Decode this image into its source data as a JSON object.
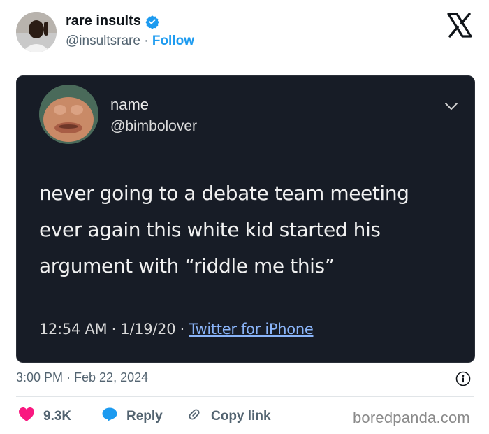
{
  "tweet": {
    "author_name": "rare insults",
    "author_handle": "@insultsrare",
    "separator": "·",
    "follow_label": "Follow",
    "timestamp": "3:00 PM · Feb 22, 2024"
  },
  "embedded_screenshot": {
    "name": "name",
    "handle": "@bimbolover",
    "text_lines": [
      "never going to a debate team meeting",
      "ever again this white kid started his",
      "argument with “riddle me this”"
    ],
    "meta_time": "12:54 AM · 1/19/20 · ",
    "meta_source": "Twitter for iPhone"
  },
  "actions": {
    "like_count": "9.3K",
    "reply_label": "Reply",
    "copy_link_label": "Copy link"
  },
  "watermark": "boredpanda.com",
  "colors": {
    "brand_blue": "#1d9bf0",
    "like_pink": "#f91880",
    "screenshot_bg": "#171c26",
    "muted_text": "#536471"
  },
  "icons": [
    "verified-badge-icon",
    "x-logo-icon",
    "chevron-down-icon",
    "info-icon",
    "heart-icon",
    "reply-bubble-icon",
    "link-icon"
  ]
}
